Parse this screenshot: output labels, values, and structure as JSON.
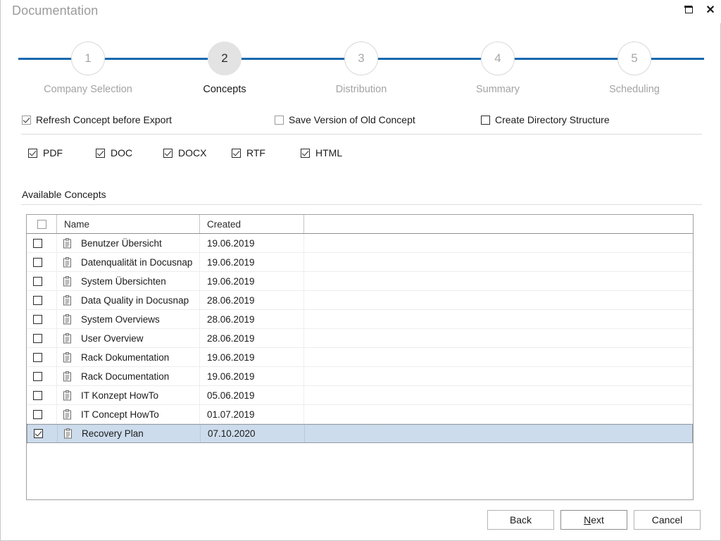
{
  "window": {
    "title": "Documentation",
    "controls": [
      {
        "name": "restore-button",
        "glyph": "restore"
      },
      {
        "name": "close-button",
        "glyph": "✕"
      }
    ]
  },
  "accent_color": "#1669b0",
  "selection_color": "#cddcec",
  "stepper": {
    "active_index": 2,
    "steps": [
      {
        "number": "1",
        "label": "Company Selection"
      },
      {
        "number": "2",
        "label": "Concepts"
      },
      {
        "number": "3",
        "label": "Distribution"
      },
      {
        "number": "4",
        "label": "Summary"
      },
      {
        "number": "5",
        "label": "Scheduling"
      }
    ]
  },
  "options": [
    {
      "label": "Refresh Concept before Export",
      "checked": true
    },
    {
      "label": "Save Version of Old Concept",
      "checked": false
    },
    {
      "label": "Create Directory Structure",
      "checked": false
    }
  ],
  "formats": [
    {
      "label": "PDF",
      "checked": true
    },
    {
      "label": "DOC",
      "checked": true
    },
    {
      "label": "DOCX",
      "checked": true
    },
    {
      "label": "RTF",
      "checked": true
    },
    {
      "label": "HTML",
      "checked": true
    }
  ],
  "concepts_section": {
    "label": "Available Concepts",
    "select_all_checked": false,
    "columns": [
      "",
      "",
      "Name",
      "Created",
      ""
    ],
    "rows": [
      {
        "checked": false,
        "name": "Benutzer Übersicht",
        "created": "19.06.2019",
        "selected": false
      },
      {
        "checked": false,
        "name": "Datenqualität in Docusnap",
        "created": "19.06.2019",
        "selected": false
      },
      {
        "checked": false,
        "name": "System Übersichten",
        "created": "19.06.2019",
        "selected": false
      },
      {
        "checked": false,
        "name": "Data Quality in Docusnap",
        "created": "28.06.2019",
        "selected": false
      },
      {
        "checked": false,
        "name": "System Overviews",
        "created": "28.06.2019",
        "selected": false
      },
      {
        "checked": false,
        "name": "User Overview",
        "created": "28.06.2019",
        "selected": false
      },
      {
        "checked": false,
        "name": "Rack Dokumentation",
        "created": "19.06.2019",
        "selected": false
      },
      {
        "checked": false,
        "name": "Rack Documentation",
        "created": "19.06.2019",
        "selected": false
      },
      {
        "checked": false,
        "name": "IT Konzept HowTo",
        "created": "05.06.2019",
        "selected": false
      },
      {
        "checked": false,
        "name": "IT Concept HowTo",
        "created": "01.07.2019",
        "selected": false
      },
      {
        "checked": true,
        "name": "Recovery Plan",
        "created": "07.10.2020",
        "selected": true
      }
    ]
  },
  "footer": {
    "back_label": "Back",
    "next_label_accel": "N",
    "next_label_rest": "ext",
    "cancel_label": "Cancel"
  }
}
